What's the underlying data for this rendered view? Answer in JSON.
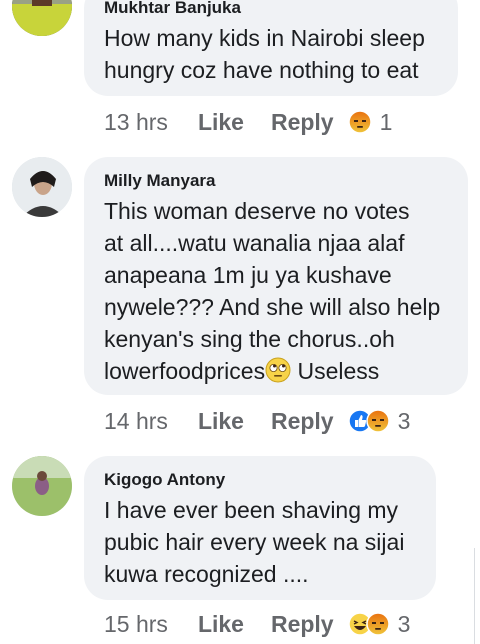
{
  "comments": [
    {
      "author": "Mukhtar Banjuka",
      "text": "How many kids in Nairobi sleep\nhungry coz have nothing to eat",
      "time": "13 hrs",
      "like": "Like",
      "reply": "Reply",
      "reactions": [
        "angry"
      ],
      "count": "1"
    },
    {
      "author": "Milly Manyara",
      "text": "This woman deserve no votes\nat all....watu wanalia njaa alaf\nanapeana 1m ju ya kushave\nnywele??? And she will also help\nkenyan's sing the chorus..oh\nlowerfoodprices",
      "text_tail": " Useless",
      "inline_emoji": "eye-roll-emoji",
      "time": "14 hrs",
      "like": "Like",
      "reply": "Reply",
      "reactions": [
        "like",
        "angry"
      ],
      "count": "3"
    },
    {
      "author": "Kigogo Antony",
      "text": "I have ever been shaving my\npubic hair every week na sijai\nkuwa recognized ....",
      "time": "15 hrs",
      "like": "Like",
      "reply": "Reply",
      "reactions": [
        "haha",
        "angry"
      ],
      "count": "3"
    }
  ],
  "colors": {
    "bubble": "#f0f2f5",
    "meta": "#65676b",
    "like_blue": "#1877f2",
    "angry_top": "#e9710f",
    "angry_bottom": "#f0c53b"
  }
}
